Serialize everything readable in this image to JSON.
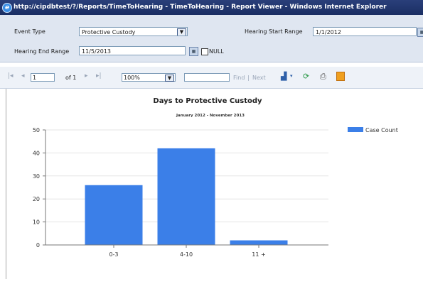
{
  "window": {
    "title": "http://cipdbtest/?/Reports/TimeToHearing - TimeToHearing - Report Viewer - Windows Internet Explorer"
  },
  "params": {
    "event_type_label": "Event Type",
    "event_type_value": "Protective Custody",
    "hearing_start_label": "Hearing Start Range",
    "hearing_start_value": "1/1/2012",
    "hearing_end_label": "Hearing End Range",
    "hearing_end_value": "11/5/2013",
    "null_label": "NULL"
  },
  "toolbar": {
    "page_value": "1",
    "page_of": "of 1",
    "zoom_value": "100%",
    "find_label": "Find",
    "find_separator": "|",
    "next_label": "Next"
  },
  "chart_data": {
    "type": "bar",
    "title": "Days to Protective Custody",
    "subtitle": "January 2012 - November 2013",
    "categories": [
      "0-3",
      "4-10",
      "11 +"
    ],
    "series": [
      {
        "name": "Case Count",
        "values": [
          26,
          42,
          2
        ],
        "color": "#3b7fe8"
      }
    ],
    "ylim": [
      0,
      50
    ],
    "yticks": [
      "0",
      "10",
      "20",
      "30",
      "40",
      "50"
    ],
    "grid": true,
    "legend": "right"
  }
}
